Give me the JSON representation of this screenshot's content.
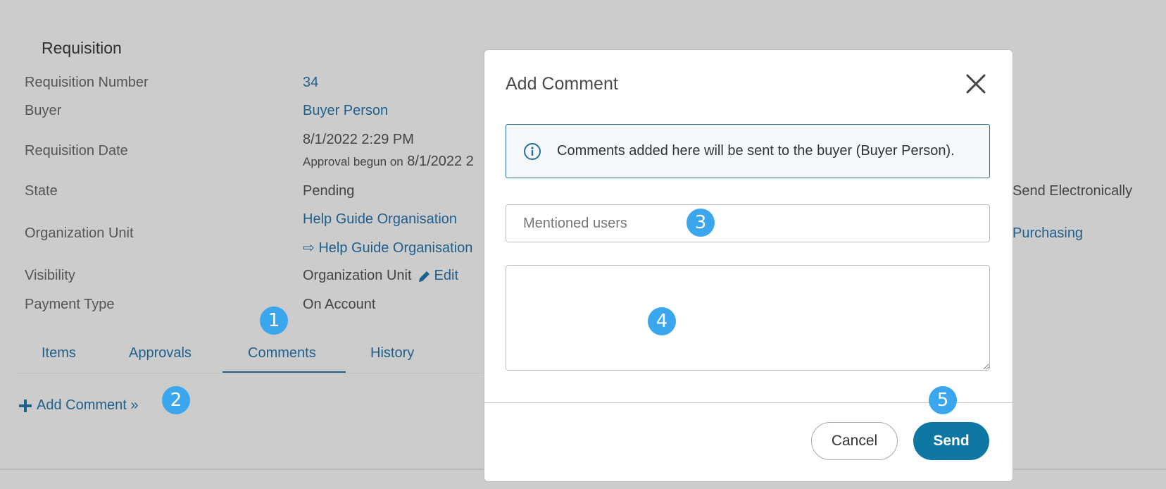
{
  "section": {
    "title": "Requisition"
  },
  "fields": {
    "requisition_number": {
      "label": "Requisition Number",
      "value": "34"
    },
    "buyer": {
      "label": "Buyer",
      "value": "Buyer Person"
    },
    "requisition_date": {
      "label": "Requisition Date",
      "value": "8/1/2022 2:29 PM",
      "approval_prefix": "Approval begun on",
      "approval_value": "8/1/2022 2"
    },
    "state": {
      "label": "State",
      "value": "Pending"
    },
    "organization_unit": {
      "label": "Organization Unit",
      "value": "Help Guide Organisation",
      "sub_value": "⇨ Help Guide Organisation"
    },
    "visibility": {
      "label": "Visibility",
      "value": "Organization Unit",
      "edit_label": "Edit"
    },
    "payment_type": {
      "label": "Payment Type",
      "value": "On Account"
    }
  },
  "right_column": {
    "send_electronically": "Send Electronically",
    "purchasing": "Purchasing"
  },
  "tabs": [
    {
      "label": "Items"
    },
    {
      "label": "Approvals"
    },
    {
      "label": "Comments",
      "active": true
    },
    {
      "label": "History"
    }
  ],
  "add_comment": {
    "label": "Add Comment »"
  },
  "badges": [
    "1",
    "2",
    "3",
    "4",
    "5"
  ],
  "modal": {
    "title": "Add Comment",
    "info_text": "Comments added here will be sent to the buyer (Buyer Person).",
    "mentions_placeholder": "Mentioned users",
    "comment_value": "",
    "cancel_label": "Cancel",
    "send_label": "Send"
  },
  "colors": {
    "link": "#1f5f8b",
    "badge": "#3aa6ee",
    "send": "#0f77a3",
    "overlay": "#cccccc"
  }
}
